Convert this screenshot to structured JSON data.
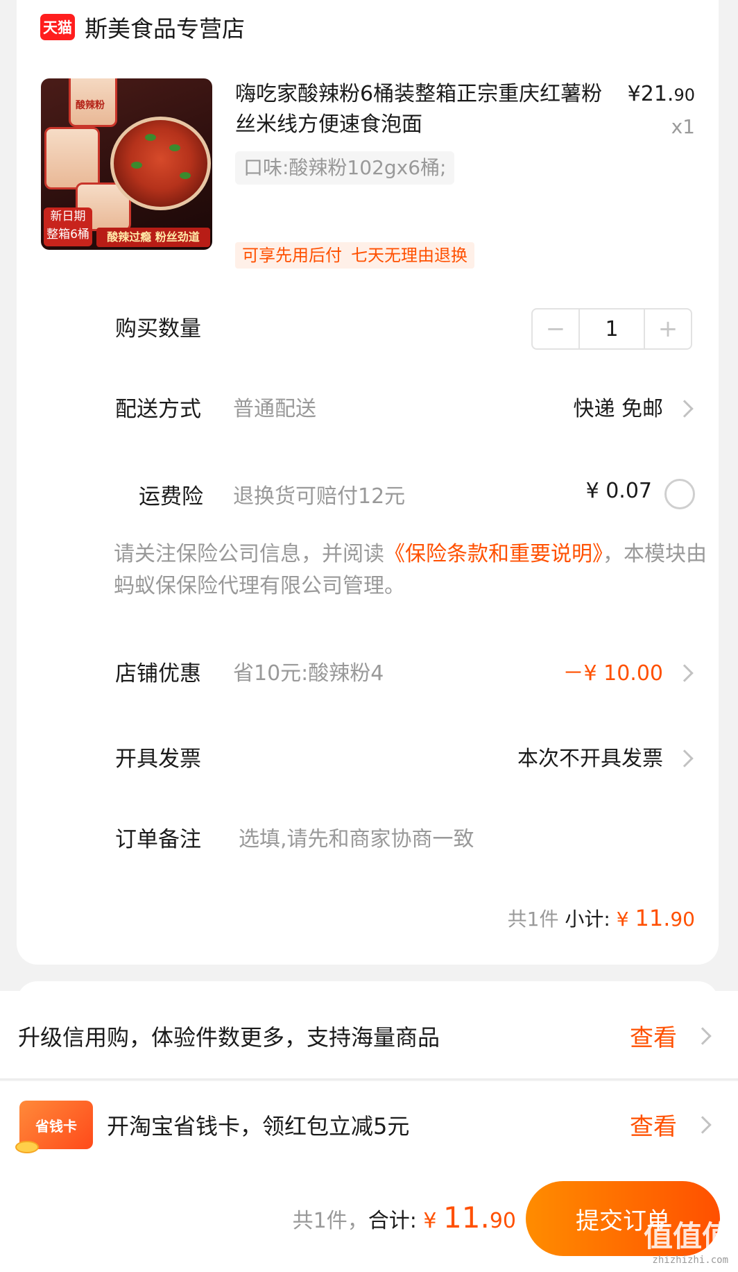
{
  "store": {
    "logo_text": "天猫",
    "name": "斯美食品专营店"
  },
  "product": {
    "title": "嗨吃家酸辣粉6桶装整箱正宗重庆红薯粉丝米线方便速食泡面",
    "price_symbol": "¥",
    "price_int": "21.",
    "price_dec": "90",
    "quantity_text": "x1",
    "spec": "口味:酸辣粉102gx6桶;",
    "tags": [
      "可享先用后付",
      "七天无理由退换"
    ],
    "image_texts": {
      "cup_label": "酸辣粉",
      "date_tag": "新日期 整箱6桶",
      "slogan": "酸辣过瘾 粉丝劲道"
    }
  },
  "rows": {
    "quantity": {
      "label": "购买数量",
      "value": "1",
      "minus": "−",
      "plus": "+"
    },
    "delivery": {
      "label": "配送方式",
      "sub": "普通配送",
      "value": "快递 免邮"
    },
    "insurance": {
      "label": "运费险",
      "sub": "退换货可赔付12元",
      "value": "¥ 0.07"
    },
    "notice": {
      "prefix": "请关注保险公司信息，并阅读",
      "link": "《保险条款和重要说明》",
      "suffix": "，本模块由蚂蚁保保险代理有限公司管理。"
    },
    "discount": {
      "label": "店铺优惠",
      "sub": "省10元:酸辣粉4",
      "value": "－¥ 10.00"
    },
    "invoice": {
      "label": "开具发票",
      "value": "本次不开具发票"
    },
    "remark": {
      "label": "订单备注",
      "placeholder": "选填,请先和商家协商一致"
    }
  },
  "subtotal": {
    "count": "共1件",
    "label": "小计:",
    "symbol": "¥",
    "int": "11.",
    "dec": "90"
  },
  "promos": [
    {
      "text": "升级信用购，体验件数更多，支持海量商品",
      "link": "查看"
    },
    {
      "icon_text": "省钱卡",
      "text": "开淘宝省钱卡，领红包立减5元",
      "link": "查看"
    }
  ],
  "footer": {
    "count": "共1件，",
    "label": "合计:",
    "symbol": "¥",
    "int": "11.",
    "dec": "90",
    "submit": "提交订单"
  },
  "watermark": {
    "text": "值值值",
    "url": "zhizhizhi.com"
  },
  "colors": {
    "accent": "#ff5000",
    "tmall_red": "#ff1e1e",
    "muted": "#999999"
  }
}
